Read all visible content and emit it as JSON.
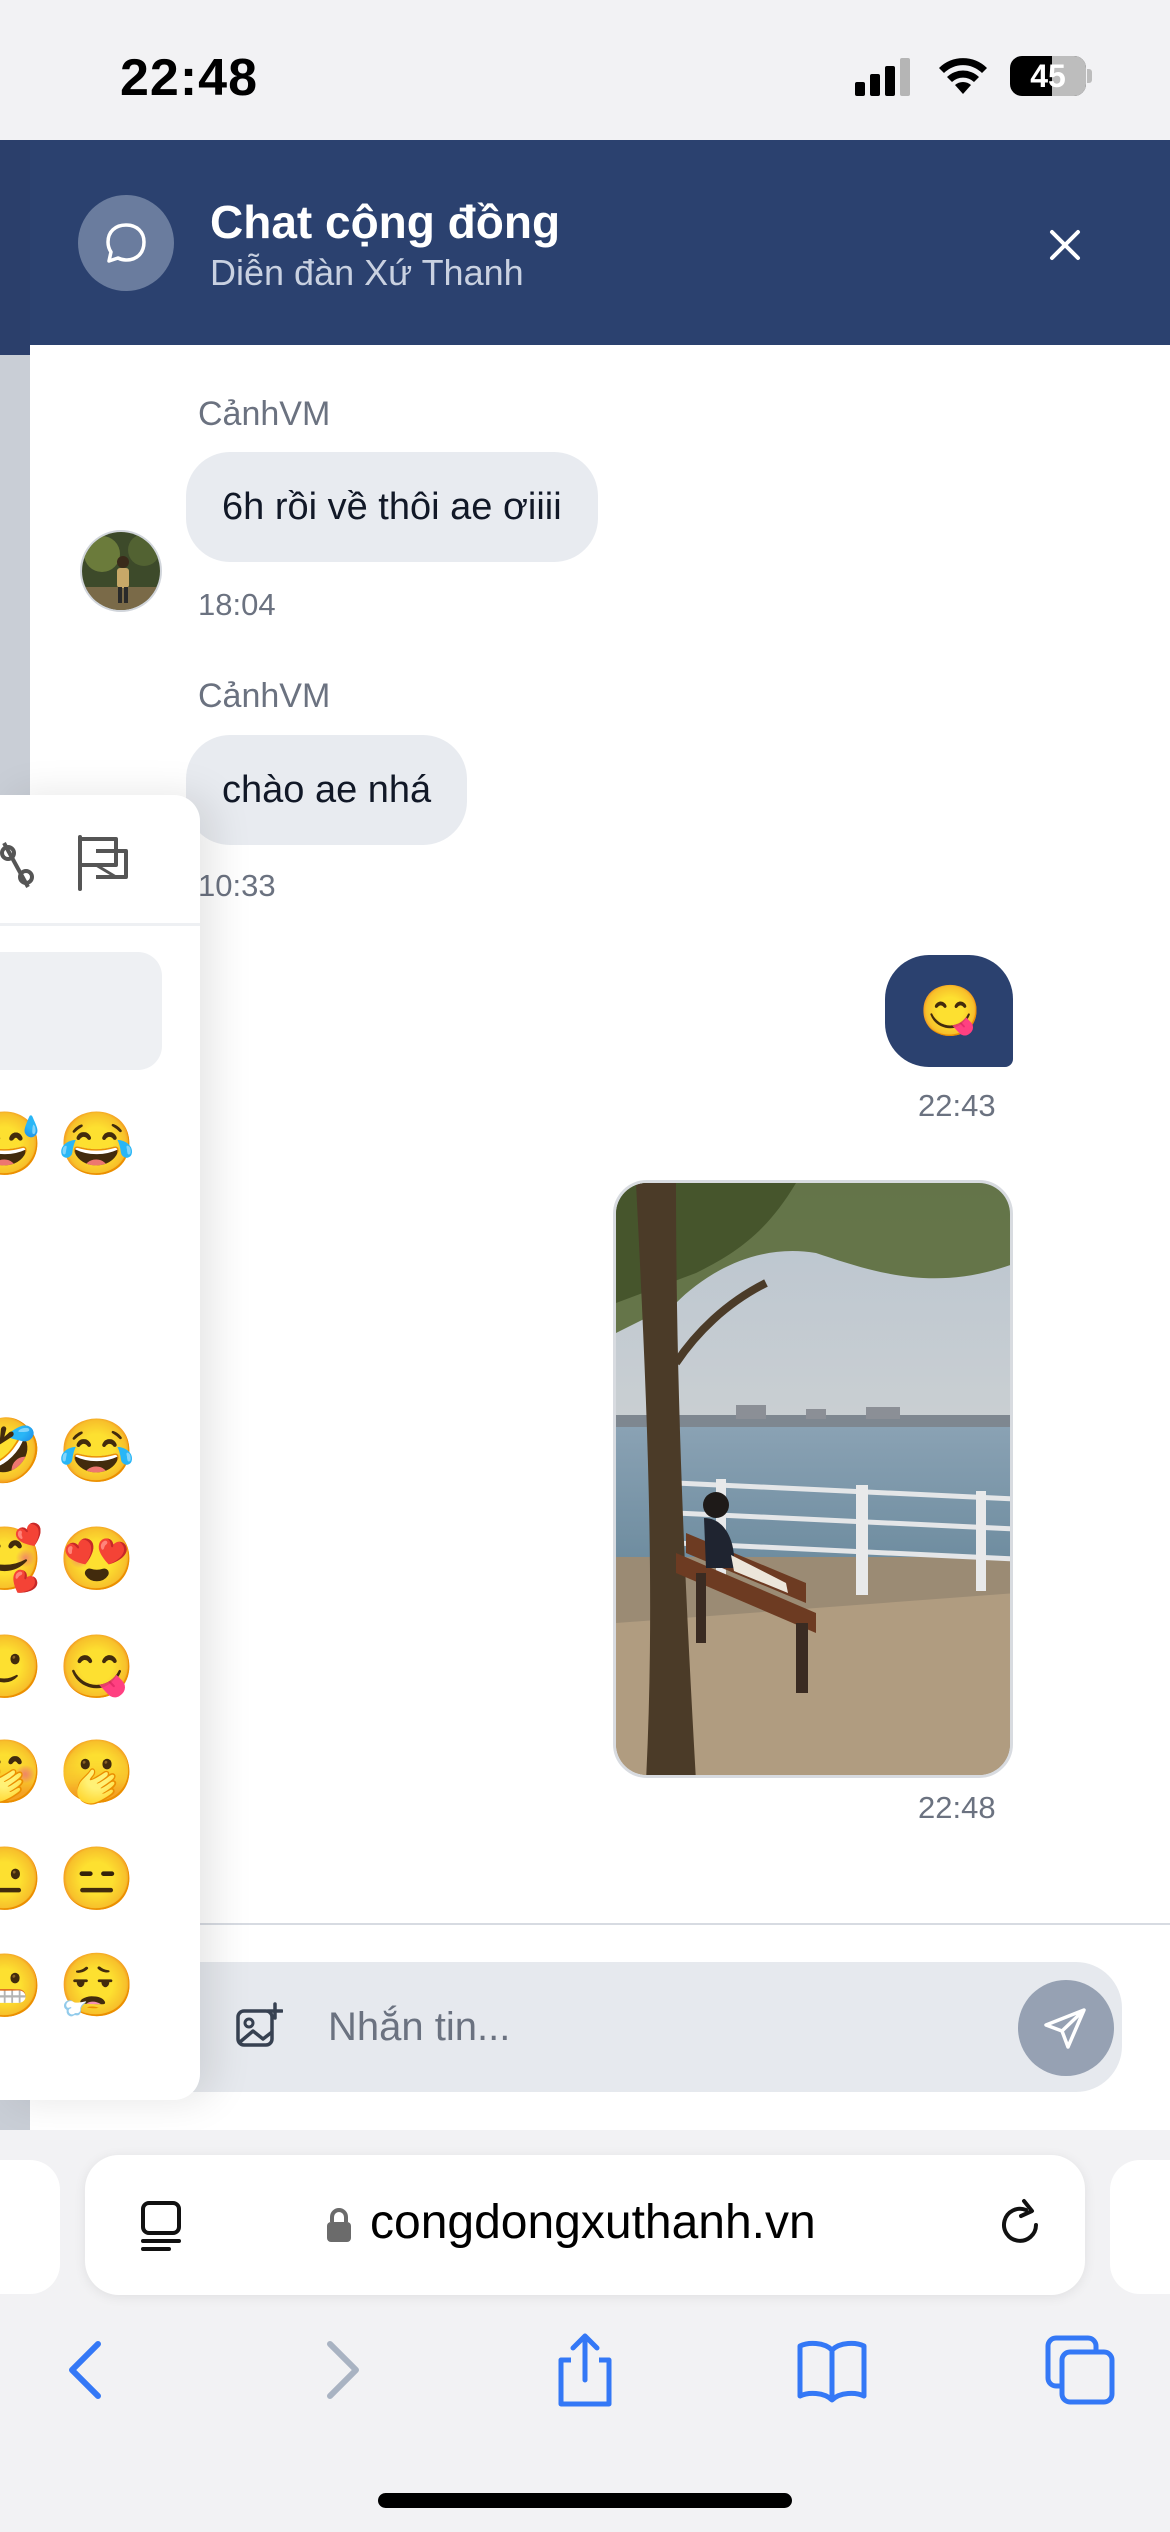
{
  "status_bar": {
    "time": "22:48",
    "battery": "45"
  },
  "header": {
    "title": "Chat cộng đồng",
    "subtitle": "Diễn đàn Xứ Thanh",
    "close_symbol": "✕",
    "icon": "chat-bubble-icon"
  },
  "messages": [
    {
      "sender": "CảnhVM",
      "text": "6h rồi về thôi ae ơiiii",
      "time": "18:04",
      "direction": "incoming"
    },
    {
      "sender": "CảnhVM",
      "text": "chào ae nhá",
      "time": "10:33",
      "direction": "incoming"
    },
    {
      "sender": "",
      "emoji": "😋",
      "time": "22:43",
      "direction": "outgoing"
    },
    {
      "sender": "",
      "image": "photo-lakeside-bench",
      "time": "22:48",
      "direction": "outgoing"
    }
  ],
  "composer": {
    "placeholder": "Nhắn tin...",
    "emoji_icon": "smiley-icon",
    "image_icon": "add-image-icon",
    "send_icon": "paper-plane-icon"
  },
  "emoji_picker": {
    "tab_icons": [
      "symbols-icon",
      "flags-icon"
    ],
    "emojis": [
      [
        "😅",
        "😂"
      ],
      [
        "🤣",
        "😂"
      ],
      [
        "🥰",
        "😍"
      ],
      [
        "🙂",
        "😋"
      ],
      [
        "🤭",
        "🫢"
      ],
      [
        "😐",
        "😑"
      ],
      [
        "😬",
        "😮‍💨"
      ]
    ]
  },
  "browser": {
    "url": "congdongxuthanh.vn",
    "icons": [
      "reader-icon",
      "lock-icon",
      "reload-icon",
      "back-icon",
      "forward-icon",
      "share-icon",
      "bookmarks-icon",
      "tabs-icon"
    ]
  },
  "colors": {
    "header": "#2b416f",
    "incoming_bubble": "#e8ebf0",
    "outgoing_bubble": "#2b416f",
    "accent_blue": "#3478f6"
  }
}
